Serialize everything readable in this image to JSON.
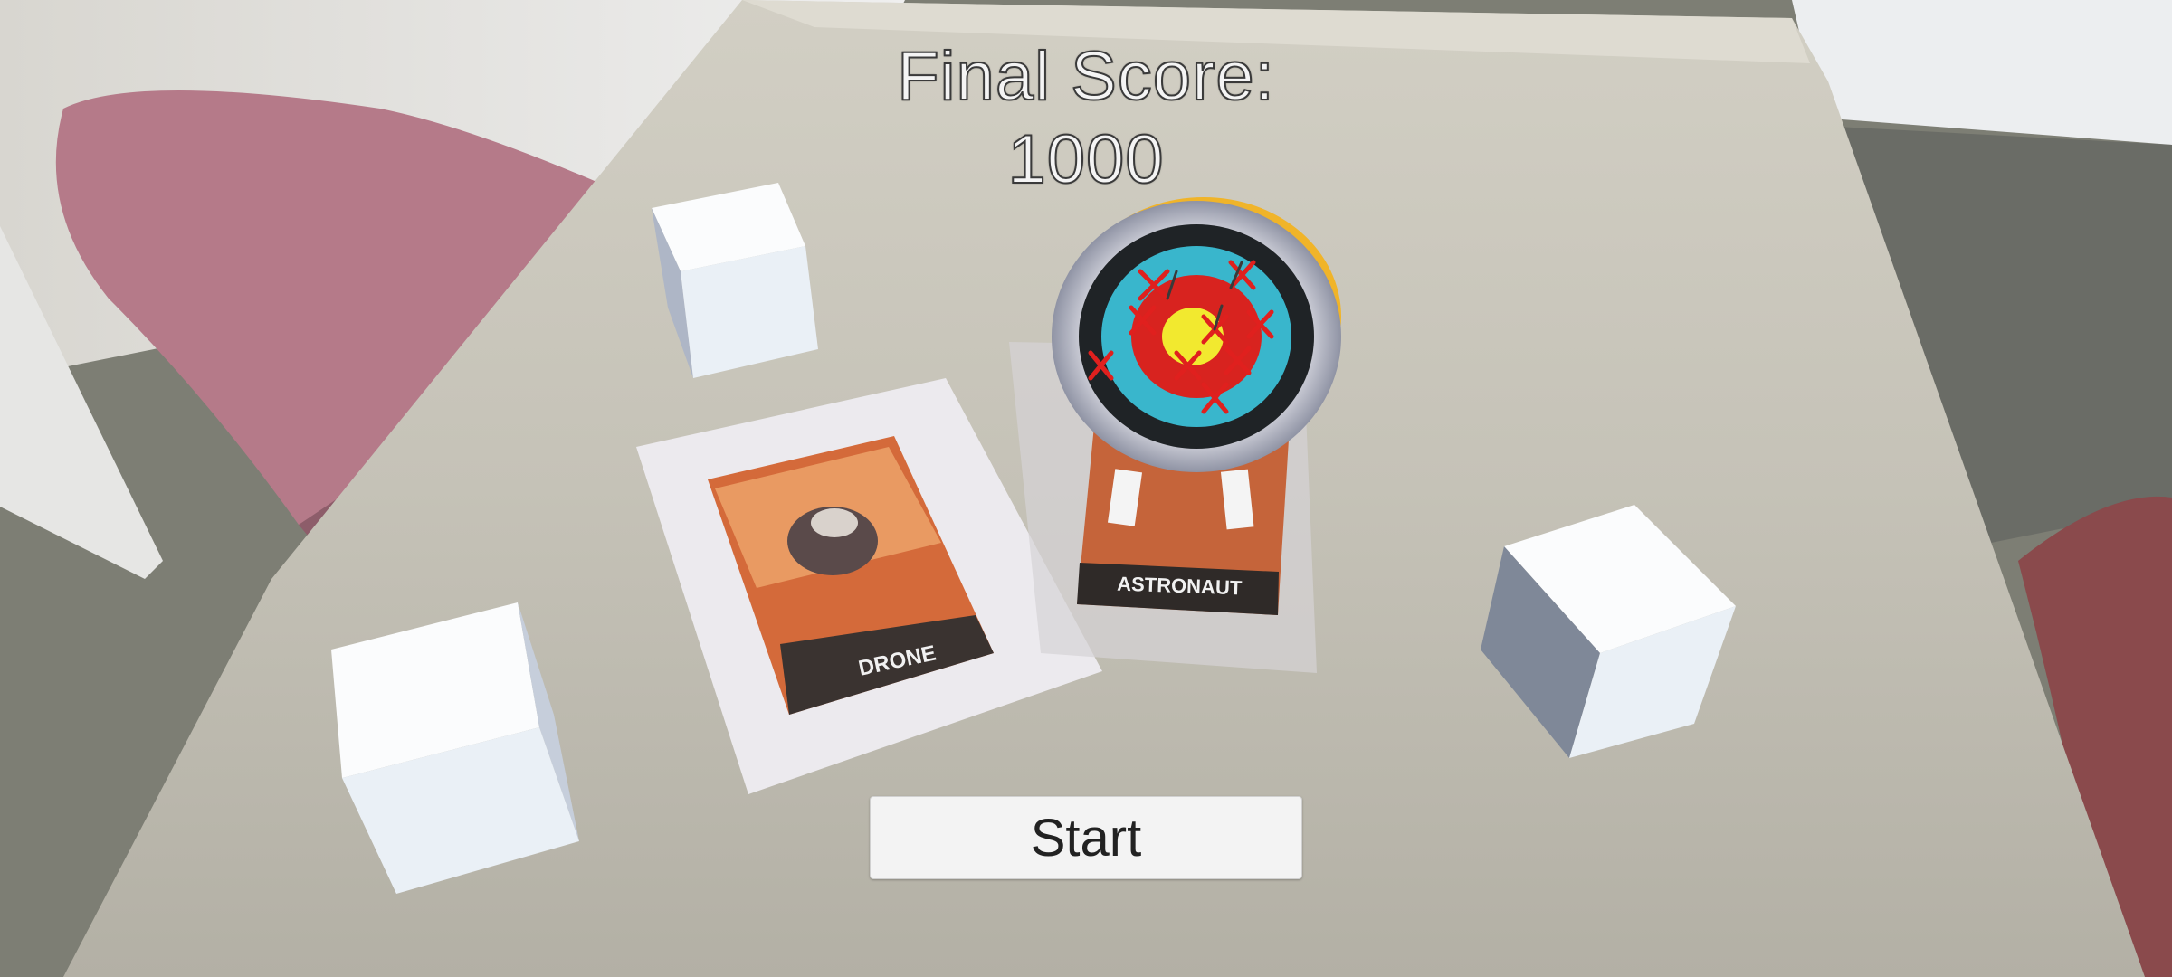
{
  "hud": {
    "score_label": "Final Score:",
    "score_value": "1000"
  },
  "start_button": {
    "label": "Start"
  },
  "cards": {
    "drone": {
      "title": "DRONE"
    },
    "astronaut": {
      "title": "ASTRONAUT"
    }
  },
  "colors": {
    "table": "#c9c6bb",
    "chair": "#b97c8c",
    "cube": "#eef2f6",
    "target_rim": "#f0b429",
    "arrow": "#e0201e"
  }
}
